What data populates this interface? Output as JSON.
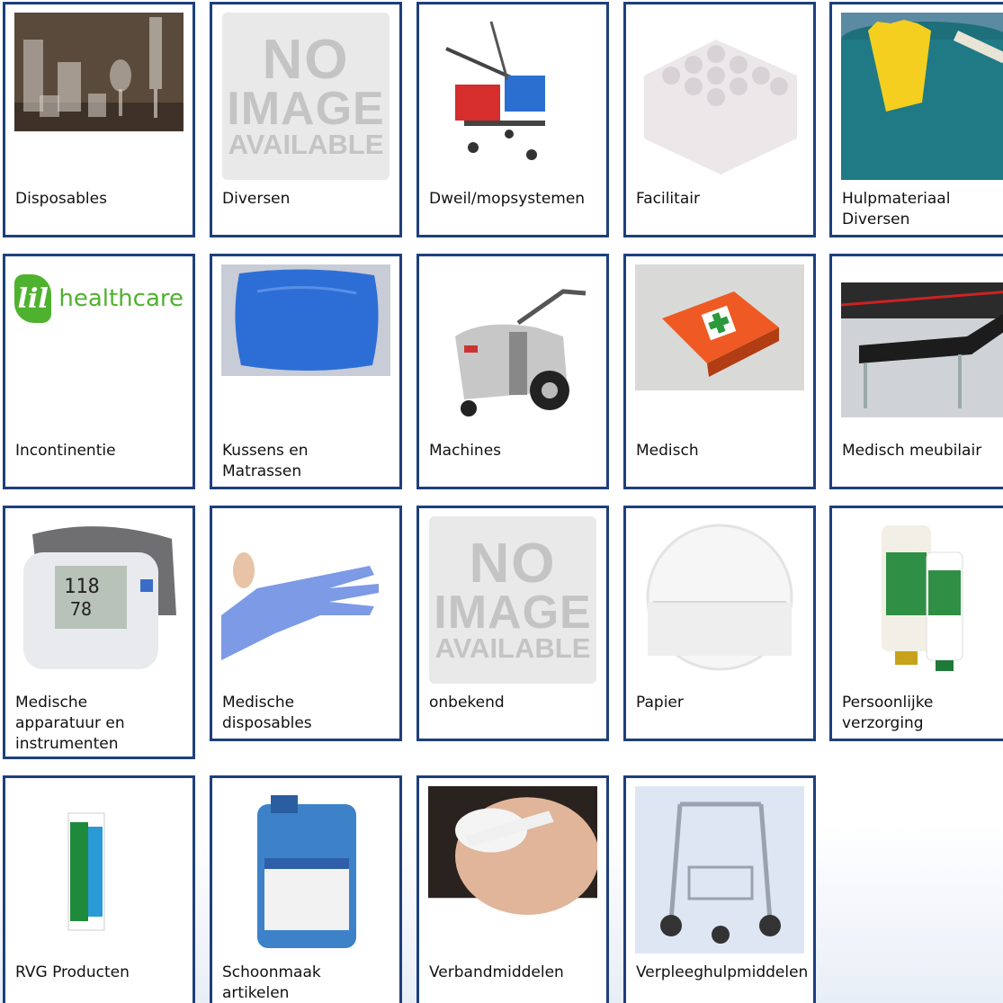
{
  "categories": [
    {
      "label": "Disposables",
      "image": "glassware-photo"
    },
    {
      "label": "Diversen",
      "image": "no-image-placeholder"
    },
    {
      "label": "Dweil/mopsystemen",
      "image": "mop-trolley-photo"
    },
    {
      "label": "Facilitair",
      "image": "toilet-rolls-photo"
    },
    {
      "label": "Hulpmateriaal\nDiversen",
      "image": "gloves-bucket-photo"
    },
    {
      "label": "Incontinentie",
      "image": "lil-healthcare-logo"
    },
    {
      "label": "Kussens en\nMatrassen",
      "image": "pillow-photo"
    },
    {
      "label": "Machines",
      "image": "cleaning-machine-photo"
    },
    {
      "label": "Medisch",
      "image": "first-aid-kit-photo"
    },
    {
      "label": "Medisch meubilair",
      "image": "examination-couch-photo"
    },
    {
      "label": "Medische\napparatuur en\ninstrumenten",
      "image": "blood-pressure-monitor-photo"
    },
    {
      "label": "Medische\ndisposables",
      "image": "nitrile-glove-photo"
    },
    {
      "label": "onbekend",
      "image": "no-image-placeholder"
    },
    {
      "label": "Papier",
      "image": "toilet-paper-dispenser-photo"
    },
    {
      "label": "Persoonlijke\nverzorging",
      "image": "skin-care-tubes-photo"
    },
    {
      "label": "RVG Producten",
      "image": "dettol-sterilon-photo"
    },
    {
      "label": "Schoonmaak\nartikelen",
      "image": "detergent-canister-photo"
    },
    {
      "label": "Verbandmiddelen",
      "image": "eye-patch-photo"
    },
    {
      "label": "Verpleeghulpmiddelen",
      "image": "rollator-photo"
    }
  ],
  "placeholder_text": {
    "line1": "NO",
    "line2": "IMAGE",
    "line3": "AVAILABLE"
  },
  "logo": {
    "mark": "lil",
    "word": "healthcare"
  },
  "colors": {
    "tile_border": "#1e3f7d",
    "logo_green": "#4fb22e",
    "placeholder_bg": "#e9e9e9"
  }
}
